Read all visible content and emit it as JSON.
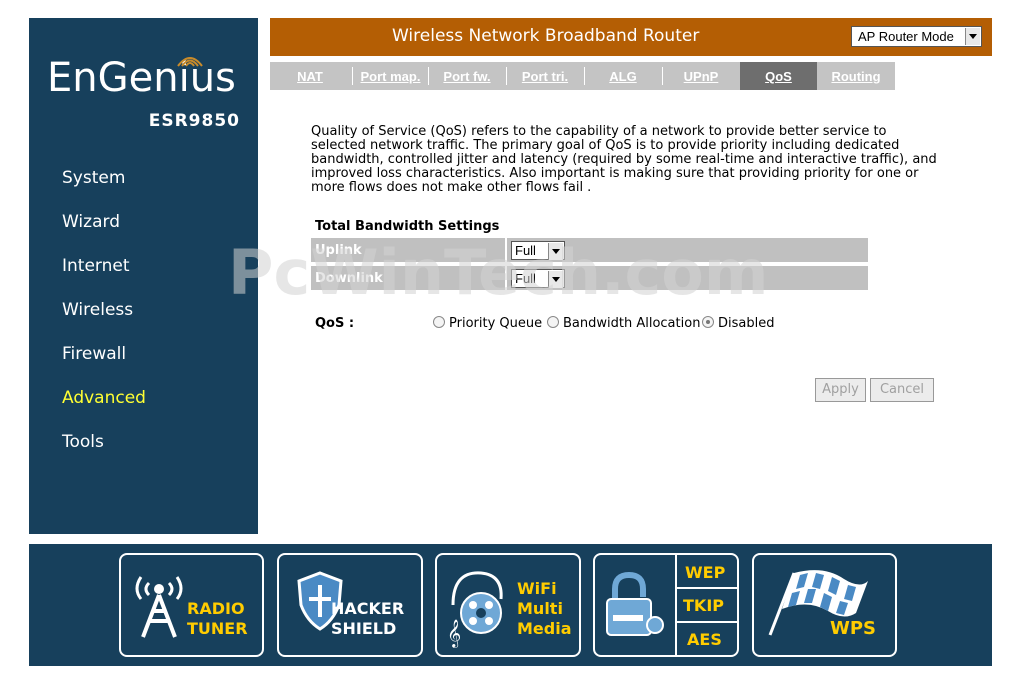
{
  "brand": {
    "logo": "EnGenius",
    "model": "ESR9850"
  },
  "sidebar": {
    "items": [
      {
        "label": "System"
      },
      {
        "label": "Wizard"
      },
      {
        "label": "Internet"
      },
      {
        "label": "Wireless"
      },
      {
        "label": "Firewall"
      },
      {
        "label": "Advanced"
      },
      {
        "label": "Tools"
      }
    ],
    "active": "Advanced"
  },
  "header": {
    "title": "Wireless Network Broadband Router",
    "mode": "AP Router Mode"
  },
  "tabs": [
    {
      "label": "NAT"
    },
    {
      "label": "Port map."
    },
    {
      "label": "Port fw."
    },
    {
      "label": "Port tri."
    },
    {
      "label": "ALG"
    },
    {
      "label": "UPnP"
    },
    {
      "label": "QoS"
    },
    {
      "label": "Routing"
    }
  ],
  "active_tab": "QoS",
  "description": "Quality of Service (QoS) refers to the capability of a network to provide better service to selected network traffic. The primary goal of QoS is to provide priority including dedicated bandwidth, controlled jitter and latency (required by some real-time and interactive traffic), and improved loss characteristics. Also important is making sure that providing priority for one or more flows does not make other flows fail .",
  "bandwidth": {
    "title": "Total Bandwidth Settings",
    "uplink_label": "Uplink",
    "uplink_value": "Full",
    "downlink_label": "Downlink",
    "downlink_value": "Full"
  },
  "qos": {
    "label": "QoS :",
    "options": [
      "Priority Queue",
      "Bandwidth Allocation",
      "Disabled"
    ],
    "selected": "Disabled"
  },
  "buttons": {
    "apply": "Apply",
    "cancel": "Cancel"
  },
  "watermark": "PcWinTech.com",
  "footer": {
    "radio": [
      "RADIO",
      "TUNER"
    ],
    "hacker": [
      "HACKER",
      "SHIELD"
    ],
    "wifi": [
      "WiFi",
      "Multi",
      "Media"
    ],
    "security": [
      "WEP",
      "TKIP",
      "AES"
    ],
    "wps": "WPS"
  },
  "colors": {
    "sidebar": "#17405c",
    "header": "#b45e04",
    "active_nav": "#ffff33",
    "footer_text": "#ffcc00"
  }
}
